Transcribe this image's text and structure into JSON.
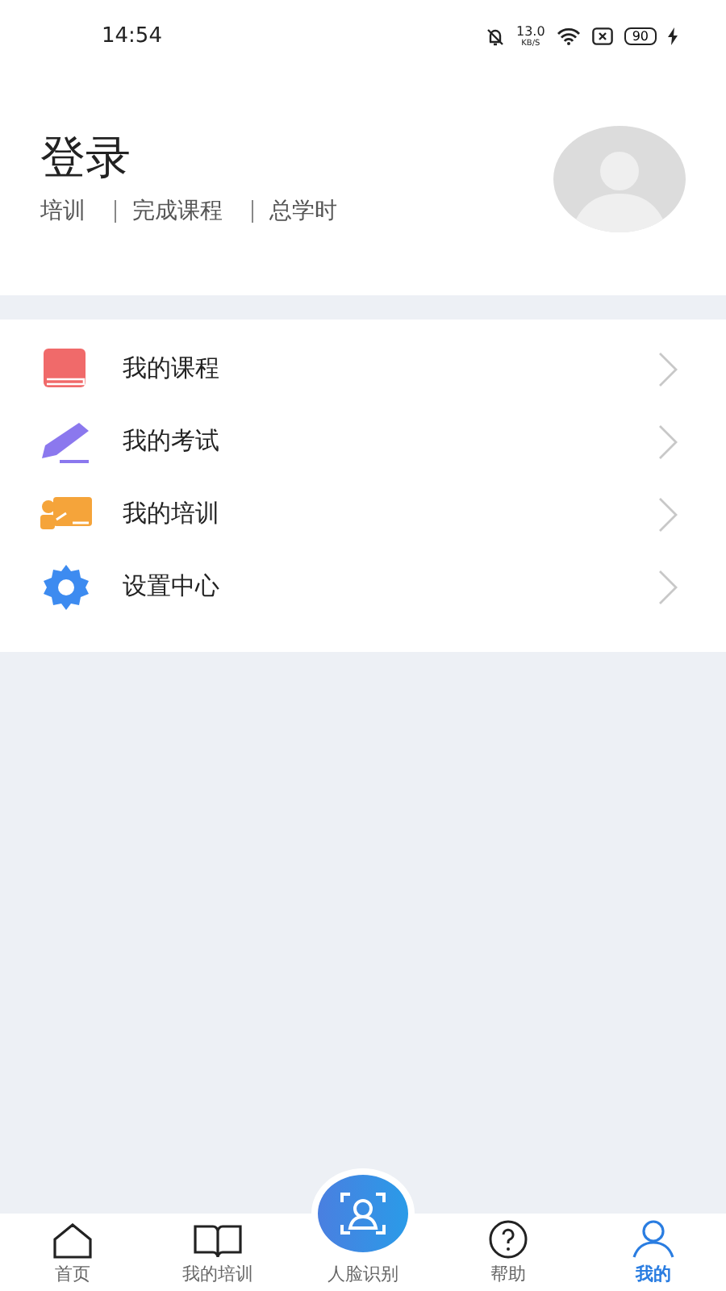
{
  "status_bar": {
    "time": "14:54",
    "speed": "13.0",
    "speed_unit": "KB/S",
    "battery": "90"
  },
  "profile": {
    "name": "登录",
    "stats": [
      "培训",
      "完成课程",
      "总学时"
    ]
  },
  "menu": [
    {
      "label": "我的课程"
    },
    {
      "label": "我的考试"
    },
    {
      "label": "我的培训"
    },
    {
      "label": "设置中心"
    }
  ],
  "tabs": [
    {
      "label": "首页",
      "selected": false
    },
    {
      "label": "我的培训",
      "selected": false
    },
    {
      "label": "人脸识别",
      "selected": false
    },
    {
      "label": "帮助",
      "selected": false
    },
    {
      "label": "我的",
      "selected": true
    }
  ]
}
